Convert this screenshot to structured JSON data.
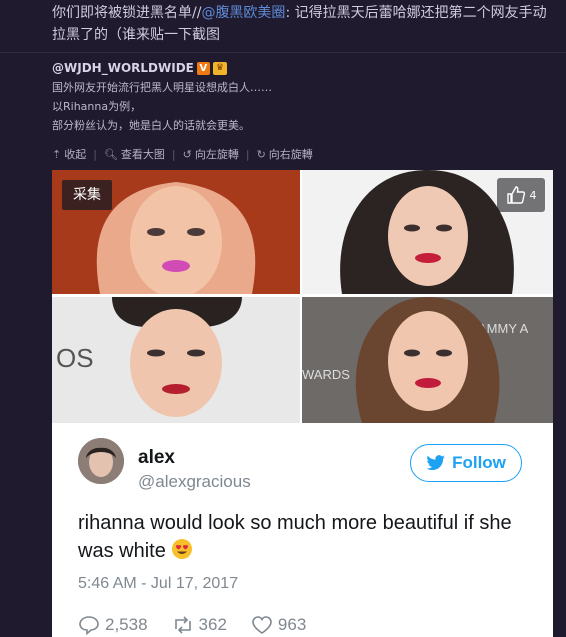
{
  "top_comment": {
    "text_before": "你们即将被锁进黑名单//",
    "mention": "@腹黑欧美圈",
    "text_after": ": 记得拉黑天后蕾哈娜还把第二个网友手动拉黑了的（谁来贴一下截图"
  },
  "repost": {
    "author": "@WJDH_WORLDWIDE",
    "verified_icon": "V",
    "badge_icon": "crown-icon",
    "lines": [
      "国外网友开始流行把黑人明星设想成白人……",
      "以Rihanna为例，",
      "部分粉丝认为，她是白人的话就会更美。"
    ],
    "actions": [
      {
        "icon": "arrow-up-icon",
        "label": "收起"
      },
      {
        "icon": "search-icon",
        "label": "查看大图"
      },
      {
        "icon": "rotate-left-icon",
        "label": "向左旋轉"
      },
      {
        "icon": "rotate-right-icon",
        "label": "向右旋轉"
      }
    ]
  },
  "photo": {
    "collect_label": "采集",
    "like_count": "4",
    "tweet": {
      "name": "alex",
      "handle": "@alexgracious",
      "follow_label": "Follow",
      "text": "rihanna would look so much more beautiful if she was white",
      "emoji": "heart-eyes-emoji",
      "time": "5:46 AM - Jul 17, 2017",
      "replies": "2,538",
      "retweets": "362",
      "likes": "963"
    }
  },
  "colors": {
    "background": "#1f1a2e",
    "mention": "#5f8bd6",
    "twitter_blue": "#1da1f2"
  }
}
